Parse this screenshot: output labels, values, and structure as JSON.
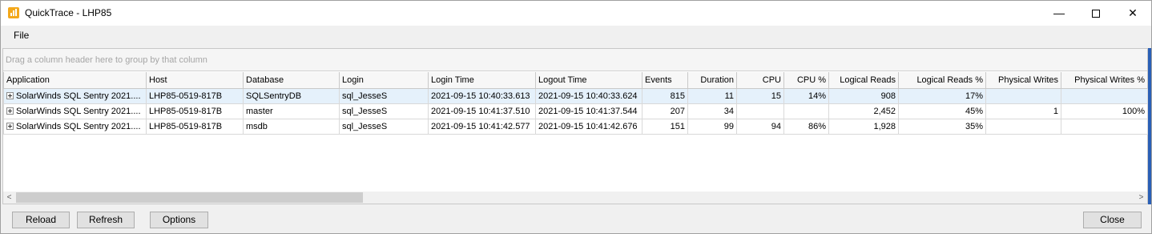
{
  "window": {
    "title": "QuickTrace - LHP85",
    "minimize_glyph": "—",
    "close_glyph": "✕"
  },
  "menu": {
    "file_label": "File"
  },
  "grid": {
    "group_panel_text": "Drag a column header here to group by that column",
    "columns": [
      "Application",
      "Host",
      "Database",
      "Login",
      "Login Time",
      "Logout Time",
      "Events",
      "Duration",
      "CPU",
      "CPU %",
      "Logical Reads",
      "Logical Reads %",
      "Physical Writes",
      "Physical Writes %"
    ],
    "rows": [
      [
        "SolarWinds SQL Sentry 2021....",
        "LHP85-0519-817B",
        "SQLSentryDB",
        "sql_JesseS",
        "2021-09-15 10:40:33.613",
        "2021-09-15 10:40:33.624",
        "815",
        "11",
        "15",
        "14%",
        "908",
        "17%",
        "",
        ""
      ],
      [
        "SolarWinds SQL Sentry 2021....",
        "LHP85-0519-817B",
        "master",
        "sql_JesseS",
        "2021-09-15 10:41:37.510",
        "2021-09-15 10:41:37.544",
        "207",
        "34",
        "",
        "",
        "2,452",
        "45%",
        "1",
        "100%"
      ],
      [
        "SolarWinds SQL Sentry 2021....",
        "LHP85-0519-817B",
        "msdb",
        "sql_JesseS",
        "2021-09-15 10:41:42.577",
        "2021-09-15 10:41:42.676",
        "151",
        "99",
        "94",
        "86%",
        "1,928",
        "35%",
        "",
        ""
      ]
    ],
    "selected_row": 0
  },
  "scrollbar": {
    "left_arrow": "<",
    "right_arrow": ">"
  },
  "buttons": {
    "reload": "Reload",
    "refresh": "Refresh",
    "options": "Options",
    "close": "Close"
  },
  "colors": {
    "app_icon": "#f3a81b",
    "selection": "#e5f1fb",
    "accent_strip": "#2a5fb6"
  },
  "icons": {
    "app": "chart-bar-icon",
    "row_expand": "plus-box-icon"
  }
}
